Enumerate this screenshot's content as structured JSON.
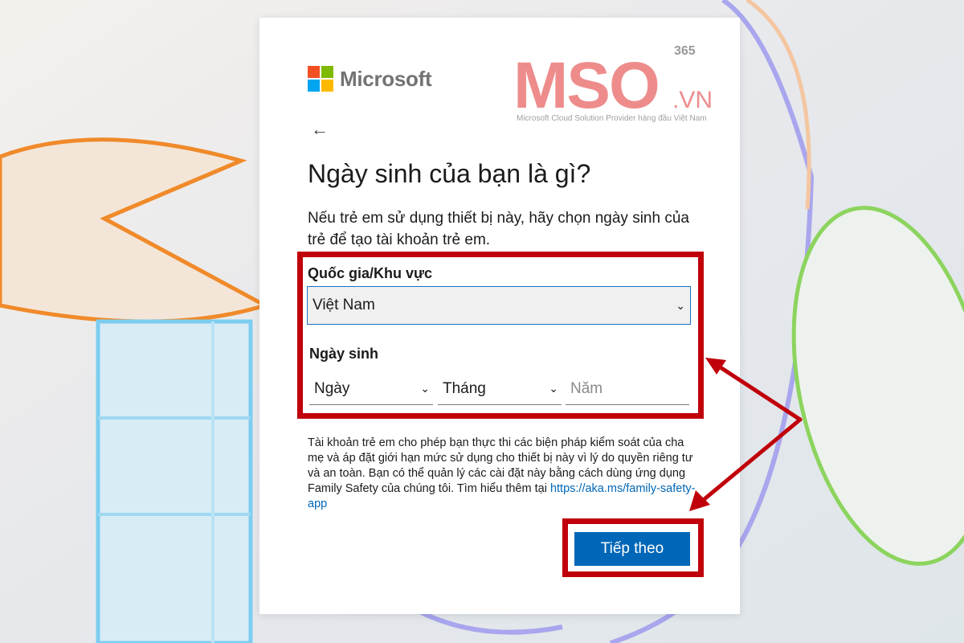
{
  "brand": {
    "name": "Microsoft",
    "logo_colors": [
      "#f25022",
      "#7fba00",
      "#00a4ef",
      "#ffb900"
    ]
  },
  "watermark": {
    "text": "MSO",
    "superscript": "365",
    "domain": ".VN",
    "tagline": "Microsoft Cloud Solution Provider hàng đầu Việt Nam",
    "color": "#ee8c8c"
  },
  "page": {
    "back_icon": "arrow-left-icon",
    "title": "Ngày sinh của bạn là gì?",
    "description": "Nếu trẻ em sử dụng thiết bị này, hãy chọn ngày sinh của trẻ để tạo tài khoản trẻ em."
  },
  "form": {
    "country_label": "Quốc gia/Khu vực",
    "country_value": "Việt Nam",
    "dob_label": "Ngày sinh",
    "day_placeholder": "Ngày",
    "month_placeholder": "Tháng",
    "year_placeholder": "Năm"
  },
  "info": {
    "text": "Tài khoản trẻ em cho phép bạn thực thi các biện pháp kiểm soát của cha mẹ và áp đặt giới hạn mức sử dụng cho thiết bị này vì lý do quyền riêng tư và an toàn. Bạn có thể quản lý các cài đặt này bằng cách dùng ứng dụng Family Safety của chúng tôi. Tìm hiểu thêm tại ",
    "link": "https://aka.ms/family-safety-app"
  },
  "actions": {
    "next_label": "Tiếp theo"
  },
  "colors": {
    "accent": "#0067b8",
    "highlight": "#c0000a"
  }
}
